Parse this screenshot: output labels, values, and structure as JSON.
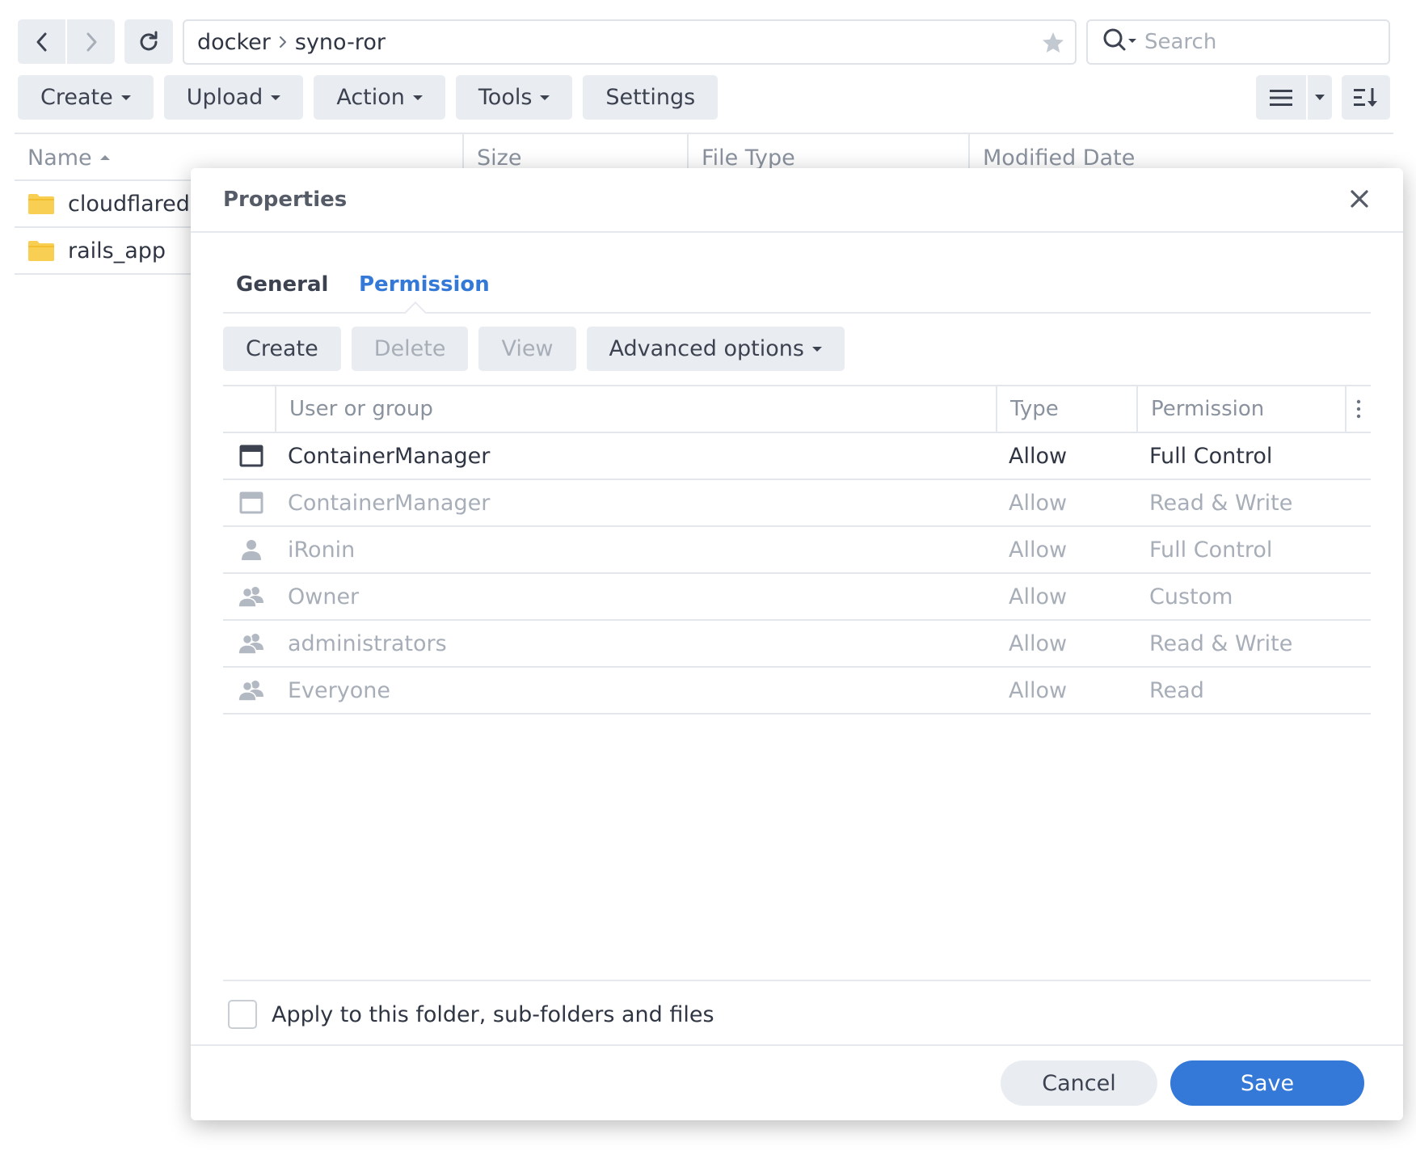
{
  "colors": {
    "accent": "#3478d8",
    "button_bg": "#e9edf1",
    "folder": "#f8cf52",
    "text": "#2f3542",
    "muted": "#a7aeb8"
  },
  "breadcrumb": {
    "parent": "docker",
    "current": "syno-ror"
  },
  "search": {
    "placeholder": "Search"
  },
  "toolbar": {
    "create": "Create",
    "upload": "Upload",
    "action": "Action",
    "tools": "Tools",
    "settings": "Settings"
  },
  "file_list": {
    "columns": {
      "name": "Name",
      "size": "Size",
      "file_type": "File Type",
      "modified": "Modified Date"
    },
    "rows": [
      {
        "name": "cloudflared",
        "icon": "folder-icon"
      },
      {
        "name": "rails_app",
        "icon": "folder-icon"
      }
    ]
  },
  "dialog": {
    "title": "Properties",
    "tabs": {
      "general": "General",
      "permission": "Permission"
    },
    "perm_toolbar": {
      "create": "Create",
      "delete": "Delete",
      "view": "View",
      "advanced": "Advanced options"
    },
    "columns": {
      "user_or_group": "User or group",
      "type": "Type",
      "permission": "Permission"
    },
    "rows": [
      {
        "icon": "app-icon",
        "name": "ContainerManager",
        "type": "Allow",
        "permission": "Full Control",
        "enabled": true
      },
      {
        "icon": "app-icon",
        "name": "ContainerManager",
        "type": "Allow",
        "permission": "Read & Write",
        "enabled": false
      },
      {
        "icon": "user-icon",
        "name": "iRonin",
        "type": "Allow",
        "permission": "Full Control",
        "enabled": false
      },
      {
        "icon": "group-icon",
        "name": "Owner",
        "type": "Allow",
        "permission": "Custom",
        "enabled": false
      },
      {
        "icon": "group-icon",
        "name": "administrators",
        "type": "Allow",
        "permission": "Read & Write",
        "enabled": false
      },
      {
        "icon": "group-icon",
        "name": "Everyone",
        "type": "Allow",
        "permission": "Read",
        "enabled": false
      }
    ],
    "apply_label": "Apply to this folder, sub-folders and files",
    "cancel": "Cancel",
    "save": "Save"
  }
}
